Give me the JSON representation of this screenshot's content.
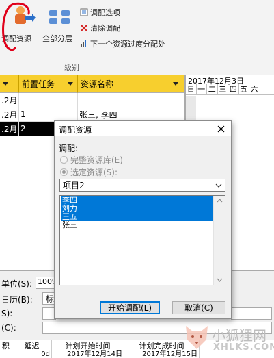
{
  "ribbon": {
    "level_btn_label": "调配资源",
    "all_level_label": "全部分层",
    "options_label": "调配选项",
    "clear_label": "清除调配",
    "next_label": "下一个资源过度分配处",
    "group_label": "级别"
  },
  "table": {
    "col_pred": "前置任务",
    "col_res": "资源名称",
    "rows": [
      {
        "date": ".2月",
        "pred": "",
        "res": ""
      },
      {
        "date": ".2月",
        "pred": "1",
        "res": "张三, 李四"
      },
      {
        "date": ".2月",
        "pred": "2",
        "res": ""
      }
    ]
  },
  "timeline": {
    "month": "2017年12月3日",
    "days": [
      "日",
      "一",
      "二",
      "三",
      "四",
      "五",
      "六"
    ]
  },
  "dialog": {
    "title": "调配资源",
    "close_icon": "close-icon",
    "level_label": "调配:",
    "opt_pool": "完整资源库(E)",
    "opt_selected": "选定资源(S):",
    "combo_value": "项目2",
    "resources": [
      "李四",
      "刘力",
      "王五",
      "张三"
    ],
    "start_btn": "开始调配(L)",
    "cancel_btn": "取消(C)"
  },
  "bottom": {
    "unit_label": "单位(S):",
    "unit_value": "100%",
    "calendar_label": "日历(B):",
    "calendar_value": "标",
    "row3_label": "S):",
    "row4_label": "(C):",
    "col_delay_prefix": "积",
    "col_delay": "延迟",
    "col_start": "计划开始时间",
    "col_finish": "计划完成时间",
    "row_delay": "0d",
    "row_start": "2017年12月14日",
    "row_finish": "2017年12月15日"
  },
  "watermark": {
    "text": "小狐狸网",
    "url": "XHLKS.COM"
  },
  "colors": {
    "accent_header": "#f7cf2e",
    "selection": "#0078d7",
    "annotation": "#e0001a"
  }
}
